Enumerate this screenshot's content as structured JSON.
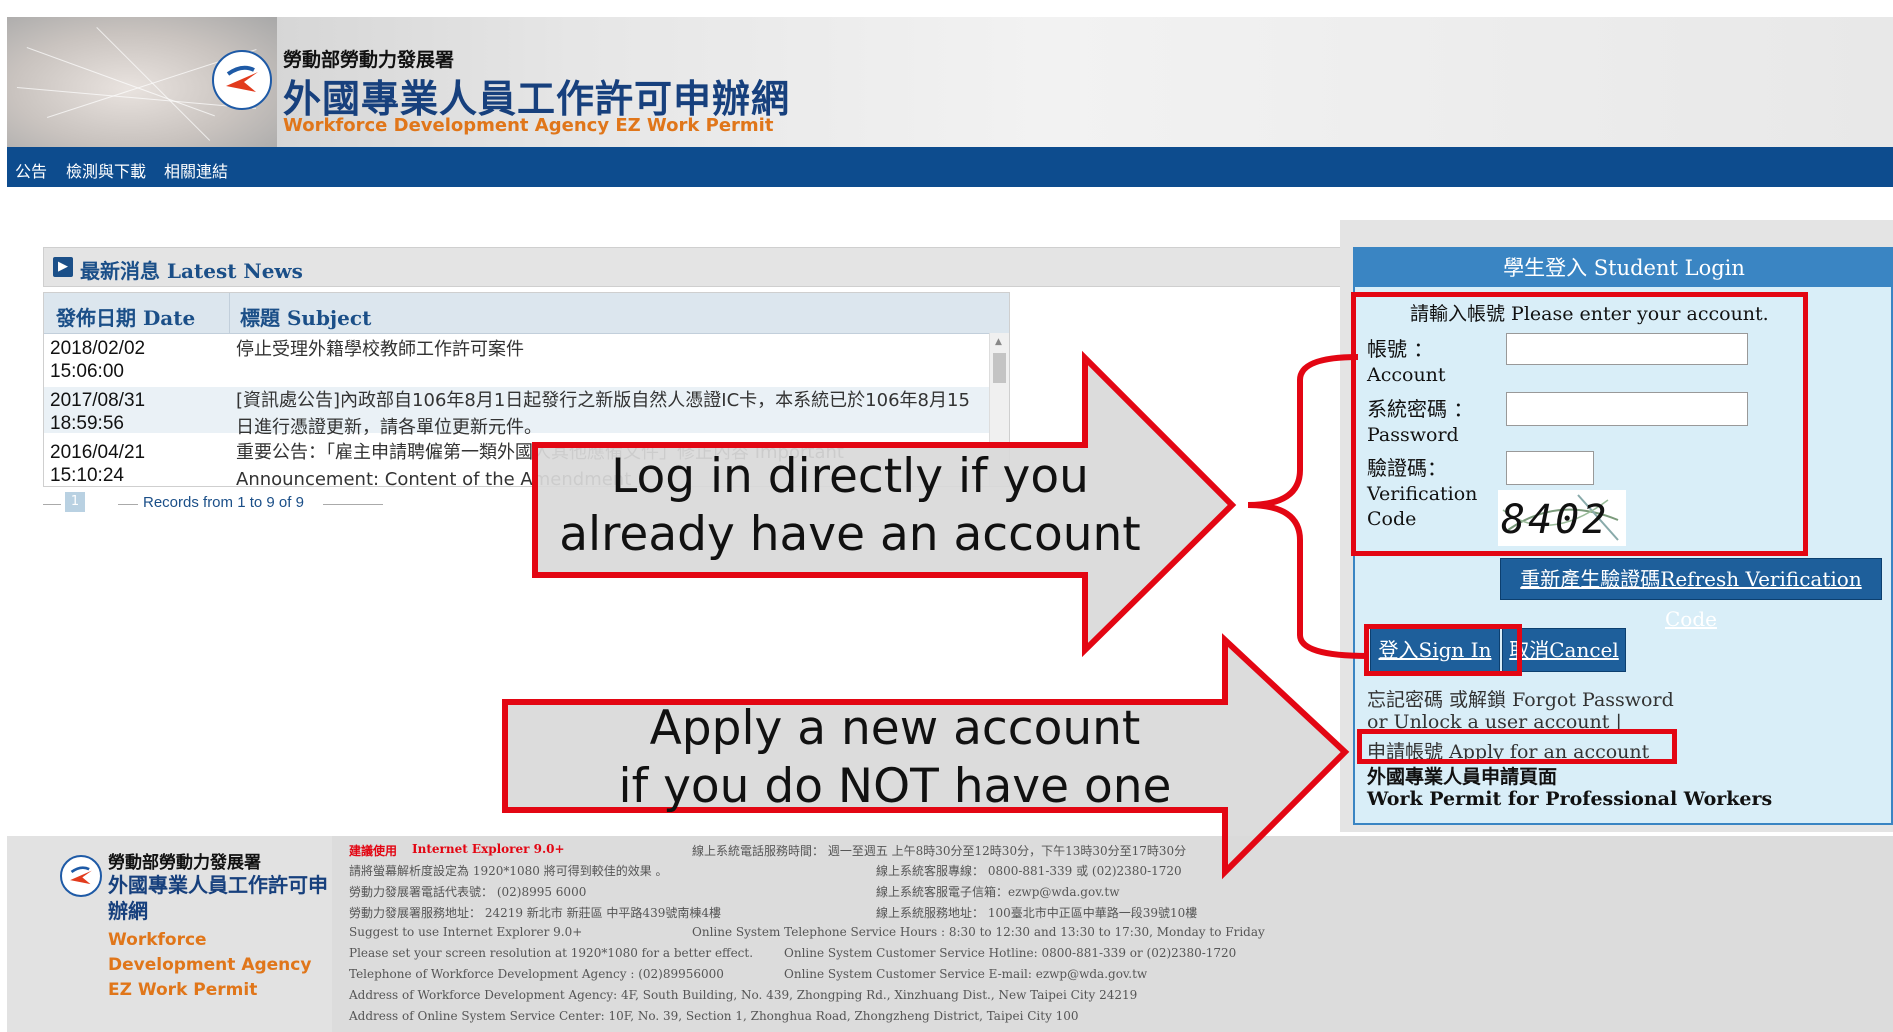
{
  "header": {
    "org": "勞動部勞動力發展署",
    "title": "外國專業人員工作許可申辦網",
    "subtitle_en": "Workforce Development Agency EZ Work Permit"
  },
  "nav": [
    "公告",
    "檢測與下載",
    "相關連結"
  ],
  "news": {
    "title": "最新消息 Latest News",
    "columns": [
      "發佈日期 Date",
      "標題 Subject"
    ],
    "rows": [
      {
        "date": "2018/02/02",
        "time": "15:06:00",
        "subject": "停止受理外籍學校教師工作許可案件"
      },
      {
        "date": "2017/08/31",
        "time": "18:59:56",
        "subject": "[資訊處公告]內政部自106年8月1日起發行之新版自然人憑證IC卡，本系統已於106年8月15日進行憑證更新，請各單位更新元件。"
      },
      {
        "date": "2016/04/21",
        "time": "15:10:24",
        "subject": "重要公告：「雇主申請聘僱第一類外國人其他應備文件」修正內容 Important Announcement: Content of the Amendment"
      }
    ],
    "page": "1",
    "records": "Records from 1 to 9 of 9"
  },
  "login": {
    "title": "學生登入 Student Login",
    "prompt": "請輸入帳號 Please enter your account.",
    "account_zh": "帳號 ：",
    "account_en": "Account",
    "password_zh": "系統密碼 ：",
    "password_en": "Password",
    "verify_zh": "驗證碼：",
    "verify_en1": "Verification",
    "verify_en2": "Code",
    "captcha": "8402",
    "refresh_btn": "重新產生驗證碼Refresh Verification Code",
    "signin_btn": "登入Sign In",
    "cancel_btn": "取消Cancel",
    "forgot": "忘記密碼 或解鎖   Forgot Password",
    "unlock": "or Unlock a user account |",
    "apply": "申請帳號   Apply for an account",
    "wp_zh": "外國專業人員申請頁面",
    "wp_en": "Work Permit for Professional Workers"
  },
  "annotations": {
    "login_callout_1": "Log in directly if you",
    "login_callout_2": "already have an account",
    "apply_callout_1": "Apply a new account",
    "apply_callout_2": "if you do NOT have one",
    "red": "#e30613"
  },
  "footer": {
    "org": "勞動部勞動力發展署",
    "title": "外國專業人員工作許可申辦網",
    "subtitle_en": "Workforce Development Agency EZ Work Permit",
    "suggest_label": "建議使用",
    "browser": "Internet Explorer 9.0+",
    "lines_left": [
      "請將螢幕解析度設定為 1920*1080   將可得到較佳的效果 。",
      "勞動力發展署電話代表號：   (02)8995 6000",
      "勞動力發展署服務地址：      24219 新北市 新莊區 中平路439號南棟4樓",
      "Suggest to use Internet Explorer 9.0+",
      "Please set your screen resolution at 1920*1080 for a better effect.",
      "Telephone of Workforce Development Agency :    (02)89956000",
      "Address of Workforce Development Agency:     4F, South Building, No. 439, Zhongping Rd., Xinzhuang Dist., New Taipei City 24219",
      "Address of Online System Service Center:     10F, No. 39, Section 1, Zhonghua Road, Zhongzheng District, Taipei City 100"
    ],
    "lines_right": [
      "線上系統電話服務時間：   週一至週五 上午8時30分至12時30分，下午13時30分至17時30分",
      "線上系統客服專線：        0800-881-339    或   (02)2380-1720",
      "線上系統客服電子信箱：ezwp@wda.gov.tw",
      "線上系統服務地址：        100臺北市中正區中華路一段39號10樓",
      "Online System Telephone Service Hours    :    8:30 to 12:30 and 13:30 to 17:30, Monday to Friday",
      "Online System Customer Service Hotline:     0800-881-339     or     (02)2380-1720",
      "Online System Customer Service E-mail: ezwp@wda.gov.tw"
    ]
  }
}
